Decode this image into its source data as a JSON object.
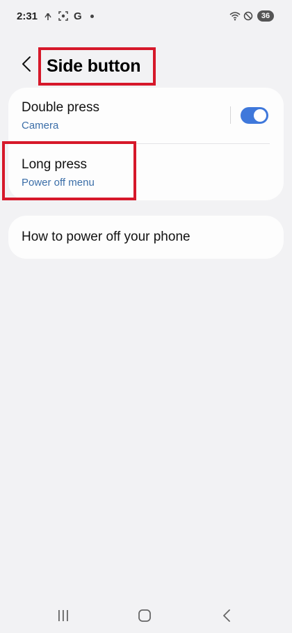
{
  "status_bar": {
    "time": "2:31",
    "g_label": "G",
    "battery": "36",
    "icons": [
      "hotspot-icon",
      "screenshot-icon",
      "google-icon",
      "notification-dot",
      "wifi-icon",
      "do-not-disturb-icon",
      "battery-icon"
    ]
  },
  "header": {
    "back_icon": "chevron-left-icon",
    "title": "Side button"
  },
  "settings": {
    "double_press": {
      "title": "Double press",
      "value": "Camera",
      "toggle_on": true
    },
    "long_press": {
      "title": "Long press",
      "value": "Power off menu"
    }
  },
  "help": {
    "title": "How to power off your phone"
  },
  "nav_bar": {
    "icons": [
      "recents-icon",
      "home-icon",
      "back-icon"
    ]
  },
  "colors": {
    "background": "#f2f2f4",
    "card": "#fdfdfd",
    "accent": "#3f78db",
    "subtitle": "#3b6ea8",
    "highlight": "#d6182a"
  }
}
